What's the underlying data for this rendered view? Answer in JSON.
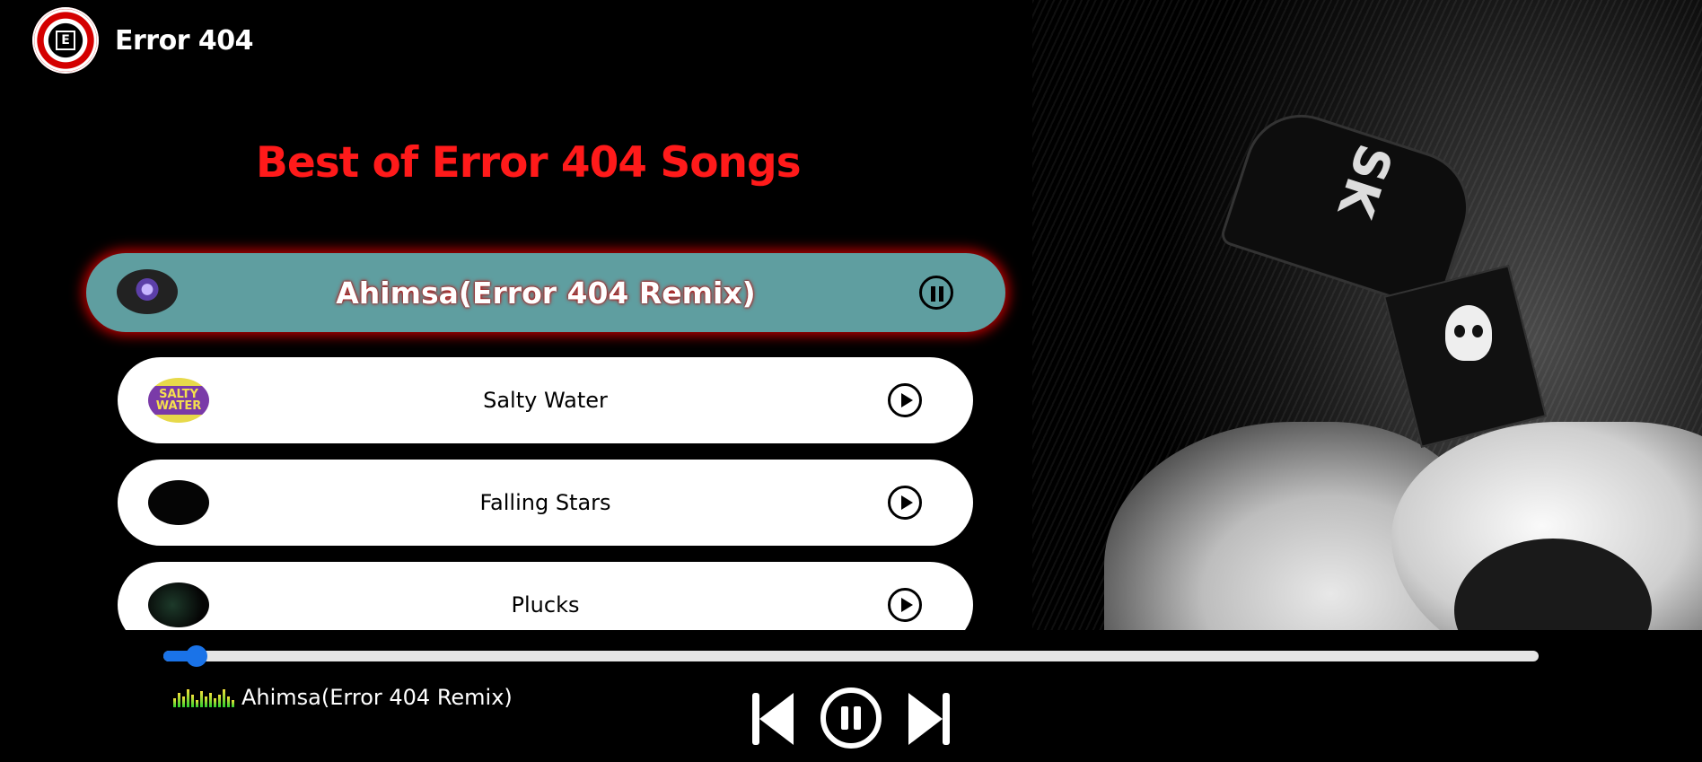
{
  "app": {
    "brand_name": "Error 404",
    "logo_icon": "error404-logo-icon"
  },
  "heading": "Best of Error 404 Songs",
  "colors": {
    "accent_red": "#ff1a1a",
    "active_row": "#5f9ea0",
    "progress_blue": "#1a73e8"
  },
  "playlist": {
    "songs": [
      {
        "title": "Ahimsa(Error 404 Remix)",
        "state": "playing",
        "control_icon": "pause-circle-icon",
        "thumb_icon": "album-art-ahimsa"
      },
      {
        "title": "Salty Water",
        "state": "paused",
        "control_icon": "play-circle-icon",
        "thumb_icon": "album-art-salty-water",
        "thumb_text": "SALTY WATER"
      },
      {
        "title": "Falling Stars",
        "state": "paused",
        "control_icon": "play-circle-icon",
        "thumb_icon": "album-art-falling-stars"
      },
      {
        "title": "Plucks",
        "state": "paused",
        "control_icon": "play-circle-icon",
        "thumb_icon": "album-art-plucks"
      }
    ]
  },
  "player": {
    "progress_fraction": 0.024,
    "now_playing_title": "Ahimsa(Error 404 Remix)",
    "equalizer_icon": "equalizer-gif-icon",
    "prev_icon": "skip-previous-icon",
    "play_pause_icon": "pause-circle-icon",
    "next_icon": "skip-next-icon"
  }
}
